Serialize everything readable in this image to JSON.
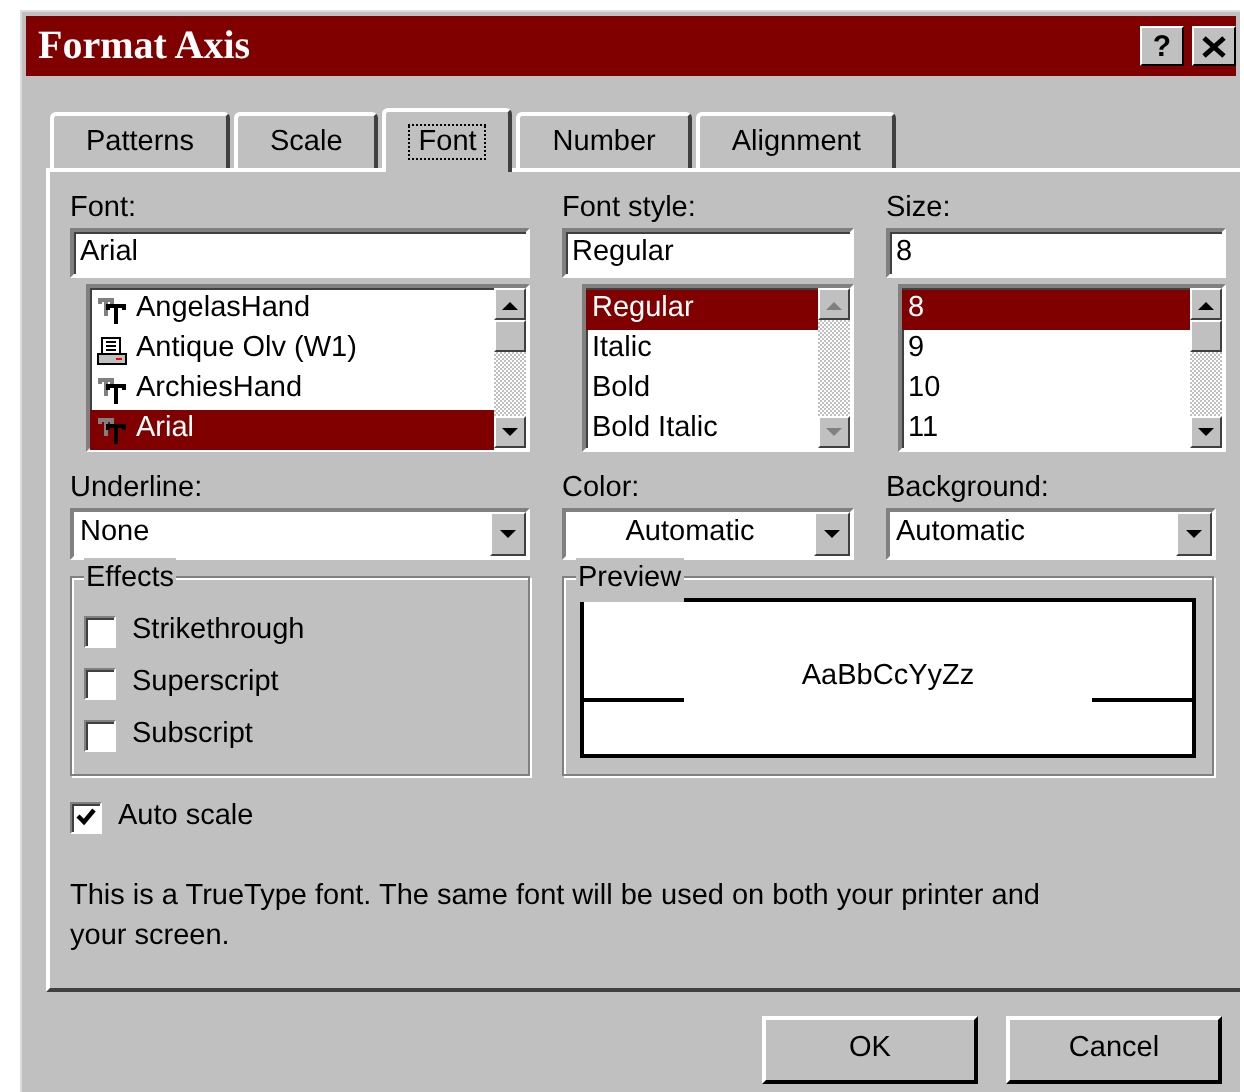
{
  "window": {
    "title": "Format Axis",
    "help": "?"
  },
  "tabs": [
    {
      "label": "Patterns",
      "selected": false
    },
    {
      "label": "Scale",
      "selected": false
    },
    {
      "label": "Font",
      "selected": true
    },
    {
      "label": "Number",
      "selected": false
    },
    {
      "label": "Alignment",
      "selected": false
    }
  ],
  "font": {
    "label": "Font:",
    "value": "Arial",
    "items": [
      {
        "label": "AngelasHand",
        "kind": "truetype",
        "selected": false
      },
      {
        "label": "Antique Olv (W1)",
        "kind": "printer",
        "selected": false
      },
      {
        "label": "ArchiesHand",
        "kind": "truetype",
        "selected": false
      },
      {
        "label": "Arial",
        "kind": "truetype",
        "selected": true
      }
    ]
  },
  "font_style": {
    "label": "Font style:",
    "value": "Regular",
    "scroll_disabled": true,
    "items": [
      {
        "label": "Regular",
        "selected": true
      },
      {
        "label": "Italic",
        "selected": false
      },
      {
        "label": "Bold",
        "selected": false
      },
      {
        "label": "Bold Italic",
        "selected": false
      }
    ]
  },
  "size": {
    "label": "Size:",
    "value": "8",
    "items": [
      {
        "label": "8",
        "selected": true
      },
      {
        "label": "9",
        "selected": false
      },
      {
        "label": "10",
        "selected": false
      },
      {
        "label": "11",
        "selected": false
      }
    ]
  },
  "underline": {
    "label": "Underline:",
    "value": "None"
  },
  "color": {
    "label": "Color:",
    "value": "Automatic"
  },
  "background": {
    "label": "Background:",
    "value": "Automatic"
  },
  "effects": {
    "title": "Effects",
    "options": [
      {
        "label": "Strikethrough",
        "checked": false
      },
      {
        "label": "Superscript",
        "checked": false
      },
      {
        "label": "Subscript",
        "checked": false
      }
    ]
  },
  "preview": {
    "title": "Preview",
    "sample": "AaBbCcYyZz"
  },
  "auto_scale": {
    "label": "Auto scale",
    "checked": true
  },
  "note": "This is a TrueType font.  The same font will be used on both your printer and your screen.",
  "buttons": [
    "OK",
    "Cancel"
  ]
}
